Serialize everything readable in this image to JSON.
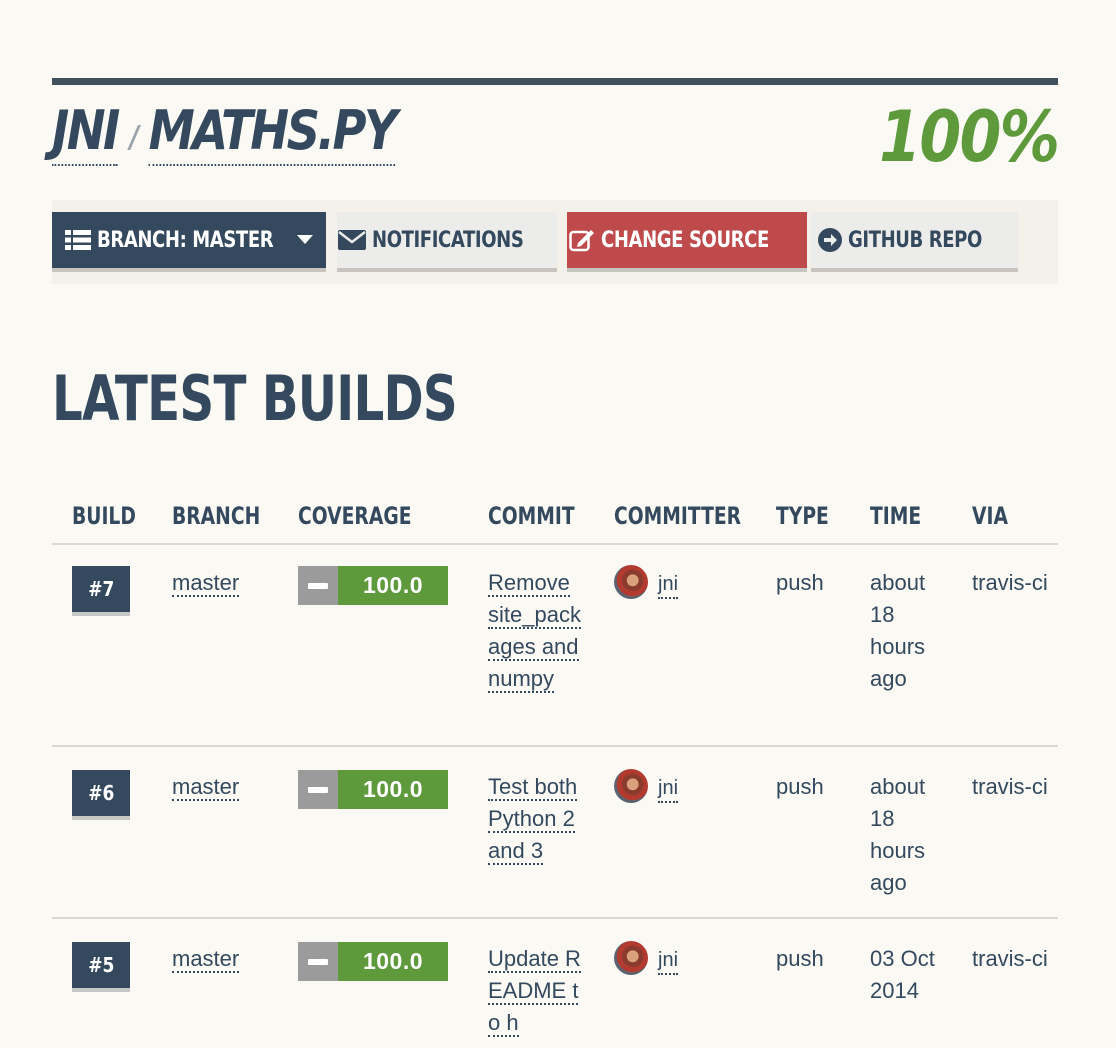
{
  "header": {
    "owner": "JNI",
    "separator": "/",
    "repo": "MATHS.PY",
    "coverage": "100%"
  },
  "toolbar": {
    "branch_label": "BRANCH: MASTER",
    "notifications_label": "NOTIFICATIONS",
    "change_source_label": "CHANGE SOURCE",
    "github_label": "GITHUB REPO"
  },
  "section": {
    "title": "LATEST BUILDS"
  },
  "table": {
    "columns": [
      "BUILD",
      "BRANCH",
      "COVERAGE",
      "COMMIT",
      "COMMITTER",
      "TYPE",
      "TIME",
      "VIA"
    ],
    "rows": [
      {
        "build": "#7",
        "branch": "master",
        "coverage": "100.0",
        "commit": "Remove site_packages and numpy",
        "committer": "jni",
        "type": "push",
        "time": "about 18 hours ago",
        "via": "travis-ci"
      },
      {
        "build": "#6",
        "branch": "master",
        "coverage": "100.0",
        "commit": "Test both Python 2 and 3",
        "committer": "jni",
        "type": "push",
        "time": "about 18 hours ago",
        "via": "travis-ci"
      },
      {
        "build": "#5",
        "branch": "master",
        "coverage": "100.0",
        "commit": "Update README to h",
        "committer": "jni",
        "type": "push",
        "time": "03 Oct 2014",
        "via": "travis-ci"
      }
    ]
  },
  "colors": {
    "primary": "#34495e",
    "success": "#5e9a3c",
    "danger": "#be4a4b",
    "neutral": "#9b9b9b"
  },
  "icons": {
    "branch": "list-icon",
    "caret": "caret-down-icon",
    "notifications": "envelope-icon",
    "change_source": "edit-icon",
    "github": "arrow-circle-right-icon"
  }
}
